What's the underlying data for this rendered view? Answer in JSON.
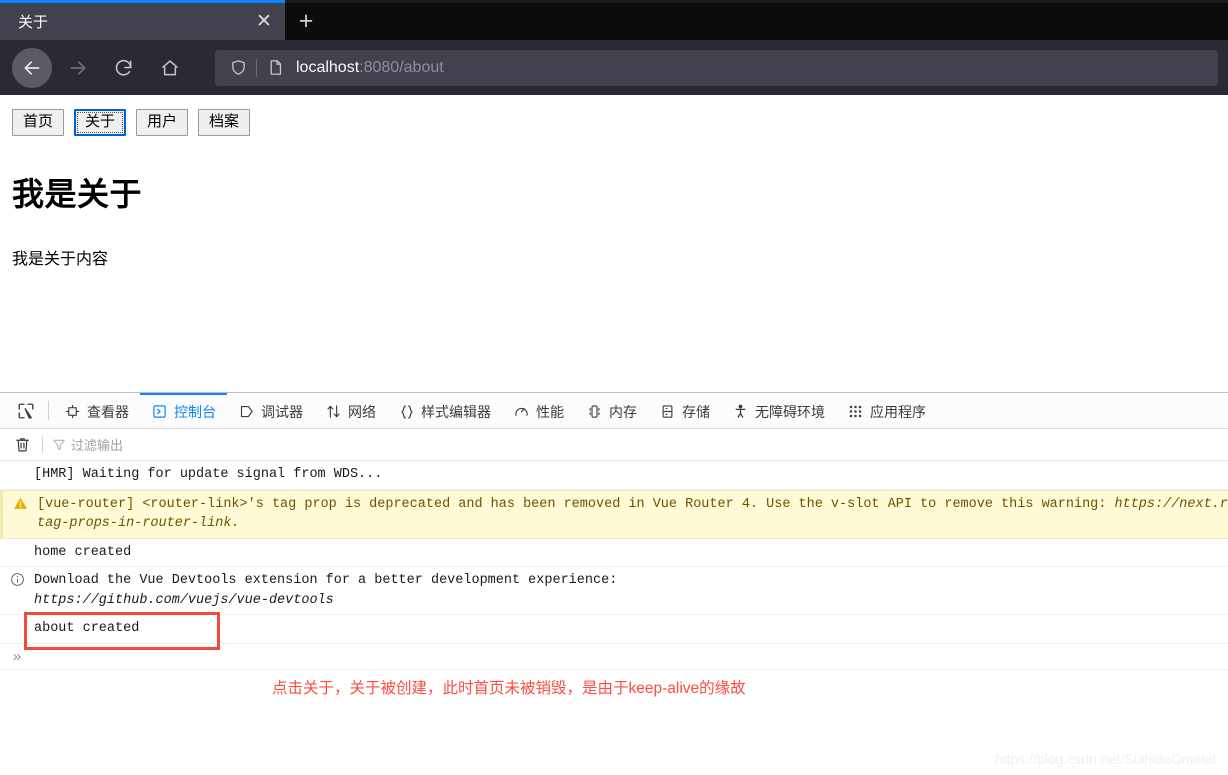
{
  "browser": {
    "tab": {
      "title": "关于",
      "close_label": "✕"
    },
    "newtab_label": "+",
    "nav": {
      "back": "back-arrow",
      "forward": "forward-arrow",
      "reload": "reload",
      "home": "home"
    },
    "urlbar": {
      "shield_icon": "shield-icon",
      "page_icon": "page-icon",
      "host": "localhost",
      "rest": ":8080/about"
    }
  },
  "page": {
    "navlinks": [
      {
        "label": "首页",
        "focused": false
      },
      {
        "label": "关于",
        "focused": true
      },
      {
        "label": "用户",
        "focused": false
      },
      {
        "label": "档案",
        "focused": false
      }
    ],
    "heading": "我是关于",
    "body": "我是关于内容"
  },
  "devtools": {
    "tabs": [
      {
        "label": "查看器",
        "icon": "inspector-icon",
        "active": false
      },
      {
        "label": "控制台",
        "icon": "console-icon",
        "active": true
      },
      {
        "label": "调试器",
        "icon": "debugger-icon",
        "active": false
      },
      {
        "label": "网络",
        "icon": "network-icon",
        "active": false
      },
      {
        "label": "样式编辑器",
        "icon": "style-editor-icon",
        "active": false
      },
      {
        "label": "性能",
        "icon": "performance-icon",
        "active": false
      },
      {
        "label": "内存",
        "icon": "memory-icon",
        "active": false
      },
      {
        "label": "存储",
        "icon": "storage-icon",
        "active": false
      },
      {
        "label": "无障碍环境",
        "icon": "accessibility-icon",
        "active": false
      },
      {
        "label": "应用程序",
        "icon": "application-icon",
        "active": false
      }
    ],
    "toolbar": {
      "clear_icon": "trash-icon",
      "filter_icon": "filter-icon",
      "filter_placeholder": "过滤输出"
    },
    "console_rows": [
      {
        "type": "log",
        "text": "[HMR] Waiting for update signal from WDS..."
      },
      {
        "type": "warning",
        "icon": "warning-icon",
        "text": "[vue-router] <router-link>'s tag prop is deprecated and has been removed in Vue Router 4. Use the v-slot API to remove this warning: ",
        "link": "https://next.rou",
        "line2": "tag-props-in-router-link."
      },
      {
        "type": "log",
        "text": "home created"
      },
      {
        "type": "info",
        "icon": "info-icon",
        "text": "Download the Vue Devtools extension for a better development experience:",
        "link": "https://github.com/vuejs/vue-devtools"
      },
      {
        "type": "log",
        "text": "about created",
        "highlighted": true
      }
    ],
    "prompt_symbol": "»"
  },
  "annotation": {
    "text": "点击关于，关于被创建，此时首页未被销毁，是由于keep-alive的缘故",
    "color": "#ff4b40"
  },
  "watermark": "https://blog.csdn.net/SuihideOmelet"
}
